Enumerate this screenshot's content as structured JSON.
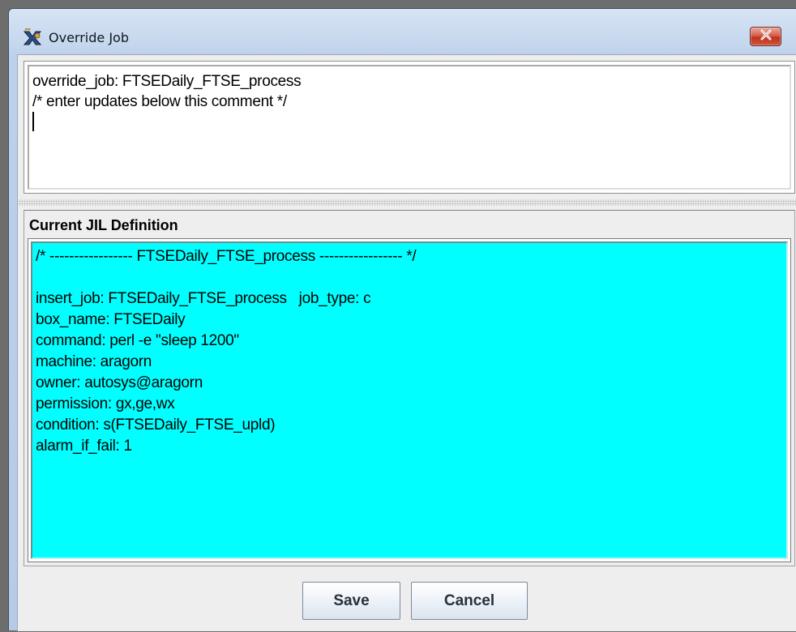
{
  "window": {
    "title": "Override Job",
    "app_icon": "app-logo-icon",
    "close_icon": "close-icon"
  },
  "editor": {
    "lines": [
      "override_job: FTSEDaily_FTSE_process",
      "/* enter updates below this comment */"
    ]
  },
  "definition": {
    "label": "Current JIL Definition",
    "lines": [
      "/* ----------------- FTSEDaily_FTSE_process ----------------- */",
      "",
      "insert_job: FTSEDaily_FTSE_process   job_type: c",
      "box_name: FTSEDaily",
      "command: perl -e \"sleep 1200\"",
      "machine: aragorn",
      "owner: autosys@aragorn",
      "permission: gx,ge,wx",
      "condition: s(FTSEDaily_FTSE_upld)",
      "alarm_if_fail: 1"
    ],
    "background_color": "#00ffff"
  },
  "buttons": {
    "save": "Save",
    "cancel": "Cancel"
  }
}
